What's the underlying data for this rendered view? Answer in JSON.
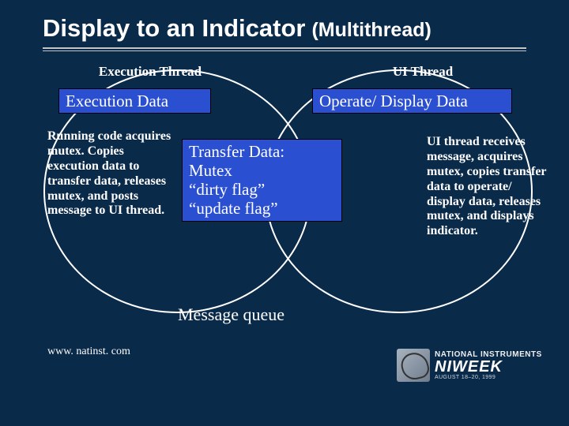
{
  "title": {
    "main": "Display to an Indicator",
    "sub": "(Multithread)"
  },
  "threads": {
    "left_label": "Execution Thread",
    "right_label": "UI Thread"
  },
  "boxes": {
    "execution_data": "Execution Data",
    "operate_display": "Operate/ Display Data",
    "transfer_line1": "Transfer Data:",
    "transfer_line2": "Mutex",
    "transfer_line3": "“dirty flag”",
    "transfer_line4": "“update flag”"
  },
  "captions": {
    "left": "Running code acquires mutex. Copies execution data to transfer data, releases mutex, and posts message to UI thread.",
    "right": "UI thread receives message, acquires mutex, copies transfer data to operate/ display data, releases mutex, and displays indicator."
  },
  "message_queue": "Message queue",
  "footer_url": "www. natinst. com",
  "logo": {
    "brand": "NATIONAL INSTRUMENTS",
    "event": "NIWEEK",
    "dates": "AUGUST 18–20, 1999"
  }
}
